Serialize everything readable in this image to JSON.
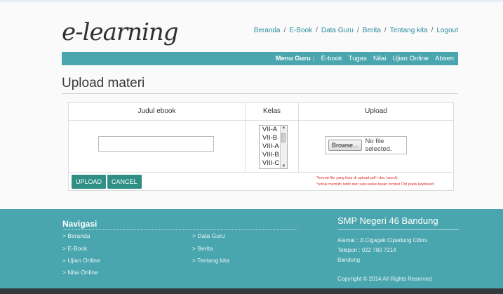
{
  "header": {
    "logo": "e-learning",
    "nav": [
      "Beranda",
      "E-Book",
      "Data Guru",
      "Berita",
      "Tentang kita",
      "Logout"
    ]
  },
  "menu": {
    "label": "Menu Guru :",
    "items": [
      "E-book",
      "Tugas",
      "Nilai",
      "Ujian Online",
      "Absen"
    ]
  },
  "page": {
    "title": "Upload materi"
  },
  "form": {
    "columns": [
      "Judul ebook",
      "Kelas",
      "Upload"
    ],
    "kelas_options": [
      "VII-A",
      "VII-B",
      "VIII-A",
      "VIII-B",
      "VIII-C"
    ],
    "browse_label": "Browse...",
    "file_status": "No file selected.",
    "upload_button": "UPLOAD",
    "cancel_button": "CANCEL",
    "note_1": "*format file yang bisa di upload pdf / doc (word).",
    "note_2": "*untuk memilih lebih dari satu kelas tekan tombol Ctrl pada keyboard"
  },
  "footer": {
    "nav_title": "Navigasi",
    "nav_left": [
      "> Beranda",
      "> E-Book",
      "> Ujian Online",
      "> Nilai Online"
    ],
    "nav_right": [
      "> Data Guru",
      "> Berita",
      "> Tentang kita"
    ],
    "school_name": "SMP Negeri 46 Bandung",
    "address": "Alamat : Jl.Cigagak Cipadung Cibiru",
    "phone": "Telepon : 022 780 7214",
    "city": "Bandung",
    "copyright": "Copyright © 2014 All Rights Reserved"
  },
  "colors": {
    "accent": "#4aa6ae",
    "button": "#2f8f85",
    "link": "#2b8ea0",
    "note": "#e03030"
  }
}
